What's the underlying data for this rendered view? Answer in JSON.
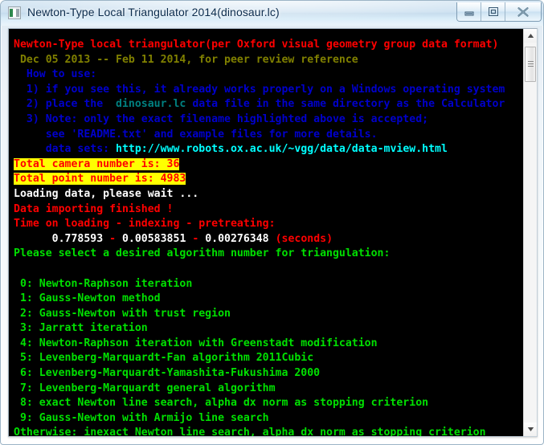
{
  "window": {
    "title": "Newton-Type Local Triangulator 2014(dinosaur.lc)",
    "icon": "application-icon",
    "buttons": {
      "minimize": "minimize-button",
      "maximize": "maximize-button",
      "close": "close-button"
    }
  },
  "colors": {
    "console_background": "#000000",
    "red": "#ff0000",
    "olive": "#808000",
    "blue": "#0000cc",
    "teal": "#008080",
    "cyan": "#00ffff",
    "white": "#ffffff",
    "green": "#00e000",
    "highlight_background": "#ffff00",
    "titlebar_text": "#0b2c4d"
  },
  "console": {
    "lines": [
      {
        "id": "header-title",
        "runs": [
          {
            "text": "Newton-Type local triangulator(per Oxford visual geometry group data format)",
            "color": "red"
          }
        ]
      },
      {
        "id": "header-dates",
        "runs": [
          {
            "text": " Dec 05 2013 -- Feb 11 2014, for peer review reference",
            "color": "olive"
          }
        ]
      },
      {
        "id": "howto-heading",
        "runs": [
          {
            "text": "  How to use:",
            "color": "blue"
          }
        ]
      },
      {
        "id": "howto-step-1",
        "runs": [
          {
            "text": "  1) if you see this, it already works properly on a Windows operating system",
            "color": "blue"
          }
        ]
      },
      {
        "id": "howto-step-2",
        "runs": [
          {
            "text": "  2) place the ",
            "color": "blue"
          },
          {
            "text": " dinosaur.lc ",
            "color": "teal"
          },
          {
            "text": "data file in the same directory as the Calculator",
            "color": "blue"
          }
        ]
      },
      {
        "id": "howto-step-3",
        "runs": [
          {
            "text": "  3) Note: only the exact filename highlighted above is accepted;",
            "color": "blue"
          }
        ]
      },
      {
        "id": "howto-readme",
        "runs": [
          {
            "text": "     see 'README.txt' and example files for more details.",
            "color": "blue"
          }
        ]
      },
      {
        "id": "howto-datasets",
        "runs": [
          {
            "text": "     data sets: ",
            "color": "blue"
          },
          {
            "text": "http://www.robots.ox.ac.uk/~vgg/data/data-mview.html",
            "color": "cyan"
          }
        ]
      },
      {
        "id": "total-camera",
        "runs": [
          {
            "text": "Total camera number is: 36",
            "color": "highlight"
          }
        ]
      },
      {
        "id": "total-point",
        "runs": [
          {
            "text": "Total point number is: 4983",
            "color": "highlight"
          }
        ]
      },
      {
        "id": "loading-status",
        "runs": [
          {
            "text": "Loading data, please wait ...",
            "color": "white"
          }
        ]
      },
      {
        "id": "import-finished",
        "runs": [
          {
            "text": "Data importing finished !",
            "color": "red"
          }
        ]
      },
      {
        "id": "timing-label",
        "runs": [
          {
            "text": "Time on loading - indexing - pretreating:",
            "color": "red"
          }
        ]
      },
      {
        "id": "timing-values",
        "runs": [
          {
            "text": "      0.778593 ",
            "color": "white"
          },
          {
            "text": "- ",
            "color": "red"
          },
          {
            "text": "0.00583851 ",
            "color": "white"
          },
          {
            "text": "- ",
            "color": "red"
          },
          {
            "text": "0.00276348 ",
            "color": "white"
          },
          {
            "text": "(seconds)",
            "color": "red"
          }
        ]
      },
      {
        "id": "prompt-select",
        "runs": [
          {
            "text": "Please select a desired algorithm number for triangulation:",
            "color": "green"
          }
        ]
      },
      {
        "id": "blank-1",
        "runs": [
          {
            "text": "",
            "color": "green"
          }
        ]
      },
      {
        "id": "algo-0",
        "runs": [
          {
            "text": " 0: Newton-Raphson iteration",
            "color": "green"
          }
        ]
      },
      {
        "id": "algo-1",
        "runs": [
          {
            "text": " 1: Gauss-Newton method",
            "color": "green"
          }
        ]
      },
      {
        "id": "algo-2",
        "runs": [
          {
            "text": " 2: Gauss-Newton with trust region",
            "color": "green"
          }
        ]
      },
      {
        "id": "algo-3",
        "runs": [
          {
            "text": " 3: Jarratt iteration",
            "color": "green"
          }
        ]
      },
      {
        "id": "algo-4",
        "runs": [
          {
            "text": " 4: Newton-Raphson iteration with Greenstadt modification",
            "color": "green"
          }
        ]
      },
      {
        "id": "algo-5",
        "runs": [
          {
            "text": " 5: Levenberg-Marquardt-Fan algorithm 2011Cubic",
            "color": "green"
          }
        ]
      },
      {
        "id": "algo-6",
        "runs": [
          {
            "text": " 6: Levenberg-Marquardt-Yamashita-Fukushima 2000",
            "color": "green"
          }
        ]
      },
      {
        "id": "algo-7",
        "runs": [
          {
            "text": " 7: Levenberg-Marquardt general algorithm",
            "color": "green"
          }
        ]
      },
      {
        "id": "algo-8",
        "runs": [
          {
            "text": " 8: exact Newton line search, alpha dx norm as stopping criterion",
            "color": "green"
          }
        ]
      },
      {
        "id": "algo-9",
        "runs": [
          {
            "text": " 9: Gauss-Newton with Armijo line search",
            "color": "green"
          }
        ]
      },
      {
        "id": "algo-otherwise",
        "runs": [
          {
            "text": "Otherwise: inexact Newton line search, alpha dx norm as stopping criterion",
            "color": "green"
          }
        ]
      }
    ]
  },
  "scrollbar": {
    "up_arrow": "scroll-up-arrow",
    "down_arrow": "scroll-down-arrow",
    "thumb": "scroll-thumb"
  }
}
